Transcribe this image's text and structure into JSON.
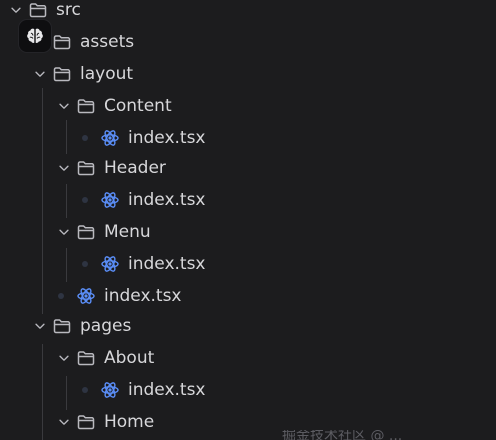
{
  "icons": {
    "chevron": "chevron-down-icon",
    "folder": "folder-open-icon",
    "react": "react-icon",
    "badge": "brain-icon"
  },
  "colors": {
    "background": "#1c1c1e",
    "text": "#d7d7da",
    "folder_icon": "#b9b9bf",
    "react_icon": "#5b8ff9",
    "guide_line": "#3a3a3e"
  },
  "tree": {
    "src": "src",
    "assets": "assets",
    "layout": "layout",
    "content": "Content",
    "content_index": "index.tsx",
    "header": "Header",
    "header_index": "index.tsx",
    "menu": "Menu",
    "menu_index": "index.tsx",
    "layout_index": "index.tsx",
    "pages": "pages",
    "about": "About",
    "about_index": "index.tsx",
    "home": "Home"
  },
  "watermark": "掘金技术社区 @ ..."
}
